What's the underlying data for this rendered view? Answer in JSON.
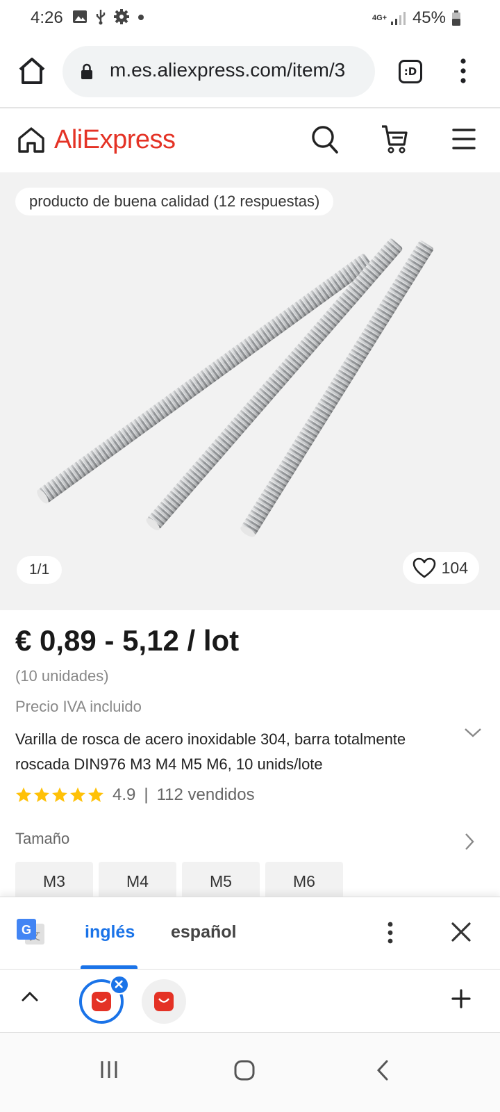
{
  "status_bar": {
    "time": "4:26",
    "network": "4G+",
    "battery": "45%"
  },
  "browser": {
    "url": "m.es.aliexpress.com/item/3",
    "tab_switcher_label": ":D"
  },
  "header": {
    "logo": "AliExpress",
    "brand_color": "#e43225"
  },
  "product": {
    "quality_chip": "producto de buena calidad (12 respuestas)",
    "image_counter": "1/1",
    "wishlist_count": "104",
    "price": "€ 0,89 - 5,12 / lot",
    "units": "(10 unidades)",
    "vat_note": "Precio IVA incluido",
    "title": "Varilla de rosca de acero inoxidable 304, barra totalmente roscada DIN976 M3 M4 M5 M6, 10 unids/lote",
    "rating": "4.9",
    "separator": "|",
    "sold": "112 vendidos",
    "star_color": "#ffc107",
    "size_label": "Tamaño",
    "sizes": [
      "M3",
      "M4",
      "M5",
      "M6"
    ]
  },
  "translate_bar": {
    "lang_source": "inglés",
    "lang_target": "español",
    "accent": "#1a73e8"
  }
}
